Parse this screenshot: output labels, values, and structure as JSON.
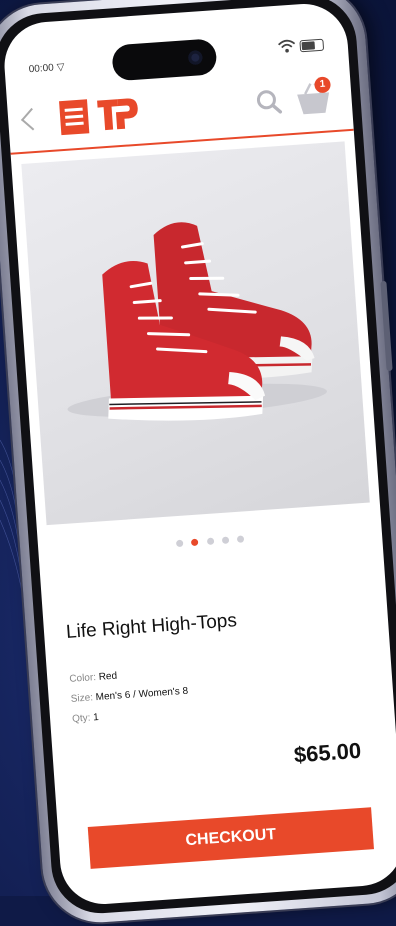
{
  "status_bar": {
    "time": "00:00",
    "network_glyph": "▽"
  },
  "header": {
    "cart_count": "1"
  },
  "carousel": {
    "count": 5,
    "active_index": 1
  },
  "product": {
    "name": "Life Right High-Tops",
    "color_label": "Color:",
    "color_value": "Red",
    "size_label": "Size:",
    "size_value": "Men's 6 / Women's 8",
    "qty_label": "Qty:",
    "qty_value": "1",
    "price": "$65.00"
  },
  "checkout_label": "CHECKOUT",
  "colors": {
    "accent": "#e8492a",
    "background": "#0f1a47",
    "shoe": "#c8282e"
  }
}
